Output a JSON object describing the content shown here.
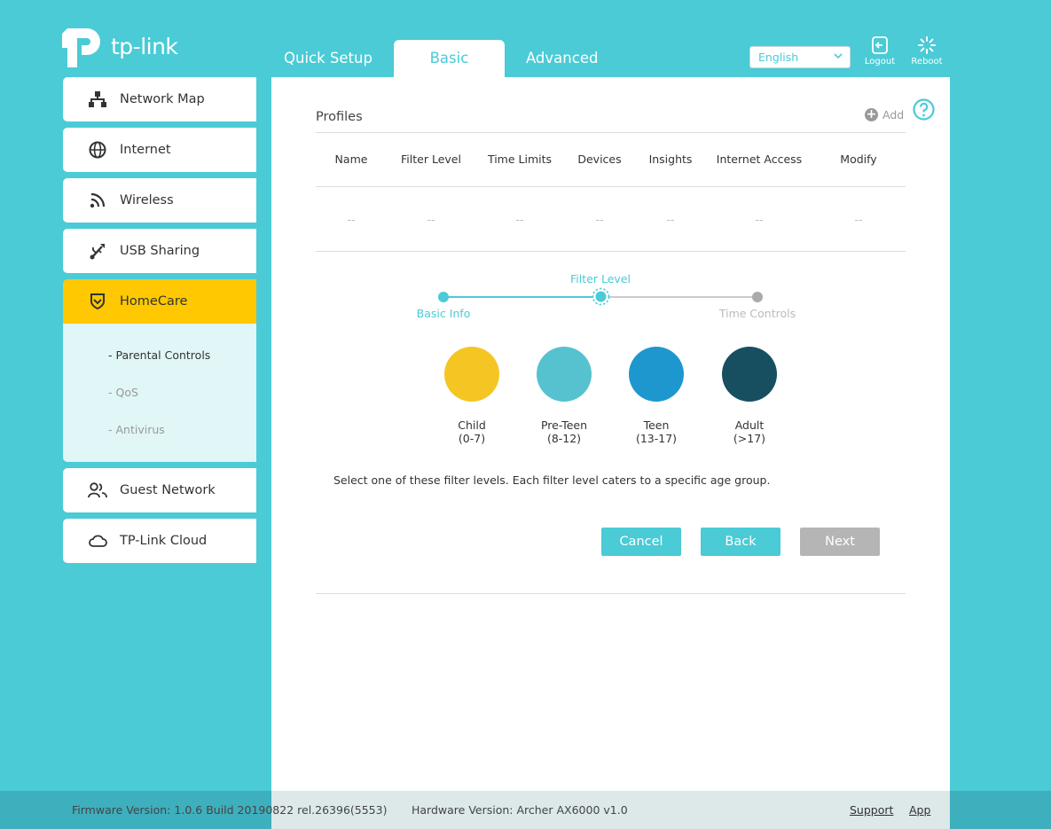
{
  "brand": {
    "logo_text": "tp-link"
  },
  "header": {
    "tabs": [
      {
        "label": "Quick Setup",
        "active": false
      },
      {
        "label": "Basic",
        "active": true
      },
      {
        "label": "Advanced",
        "active": false
      }
    ],
    "language": "English",
    "logout_label": "Logout",
    "reboot_label": "Reboot"
  },
  "sidebar": {
    "items": [
      {
        "label": "Network Map",
        "icon": "network-map-icon"
      },
      {
        "label": "Internet",
        "icon": "globe-icon"
      },
      {
        "label": "Wireless",
        "icon": "wireless-icon"
      },
      {
        "label": "USB Sharing",
        "icon": "usb-icon"
      },
      {
        "label": "HomeCare",
        "icon": "shield-icon",
        "active": true
      },
      {
        "label": "Guest Network",
        "icon": "guests-icon"
      },
      {
        "label": "TP-Link Cloud",
        "icon": "cloud-icon"
      }
    ],
    "submenu": [
      {
        "label": "- Parental Controls",
        "active": true
      },
      {
        "label": "- QoS"
      },
      {
        "label": "- Antivirus"
      }
    ]
  },
  "main": {
    "title": "Profiles",
    "add_label": "Add",
    "table": {
      "headers": [
        "Name",
        "Filter Level",
        "Time Limits",
        "Devices",
        "Insights",
        "Internet Access",
        "Modify"
      ],
      "row": [
        "--",
        "--",
        "--",
        "--",
        "--",
        "--",
        "--"
      ]
    },
    "stepper": {
      "steps": [
        "Basic Info",
        "Filter Level",
        "Time Controls"
      ],
      "current": 1
    },
    "levels": [
      {
        "name": "Child",
        "range": "(0-7)",
        "color": "#f5c623"
      },
      {
        "name": "Pre-Teen",
        "range": "(8-12)",
        "color": "#56c2cf"
      },
      {
        "name": "Teen",
        "range": "(13-17)",
        "color": "#1e97cf"
      },
      {
        "name": "Adult",
        "range": "(>17)",
        "color": "#174f61"
      }
    ],
    "description": "Select one of these filter levels. Each filter level caters to a specific age group.",
    "buttons": {
      "cancel": "Cancel",
      "back": "Back",
      "next": "Next"
    }
  },
  "footer": {
    "firmware": "Firmware Version: 1.0.6 Build 20190822 rel.26396(5553)",
    "hardware": "Hardware Version: Archer AX6000 v1.0",
    "support": "Support",
    "app": "App"
  },
  "colors": {
    "accent": "#4acbd6",
    "active_menu": "#ffc800",
    "next_disabled": "#b5b5b5"
  }
}
